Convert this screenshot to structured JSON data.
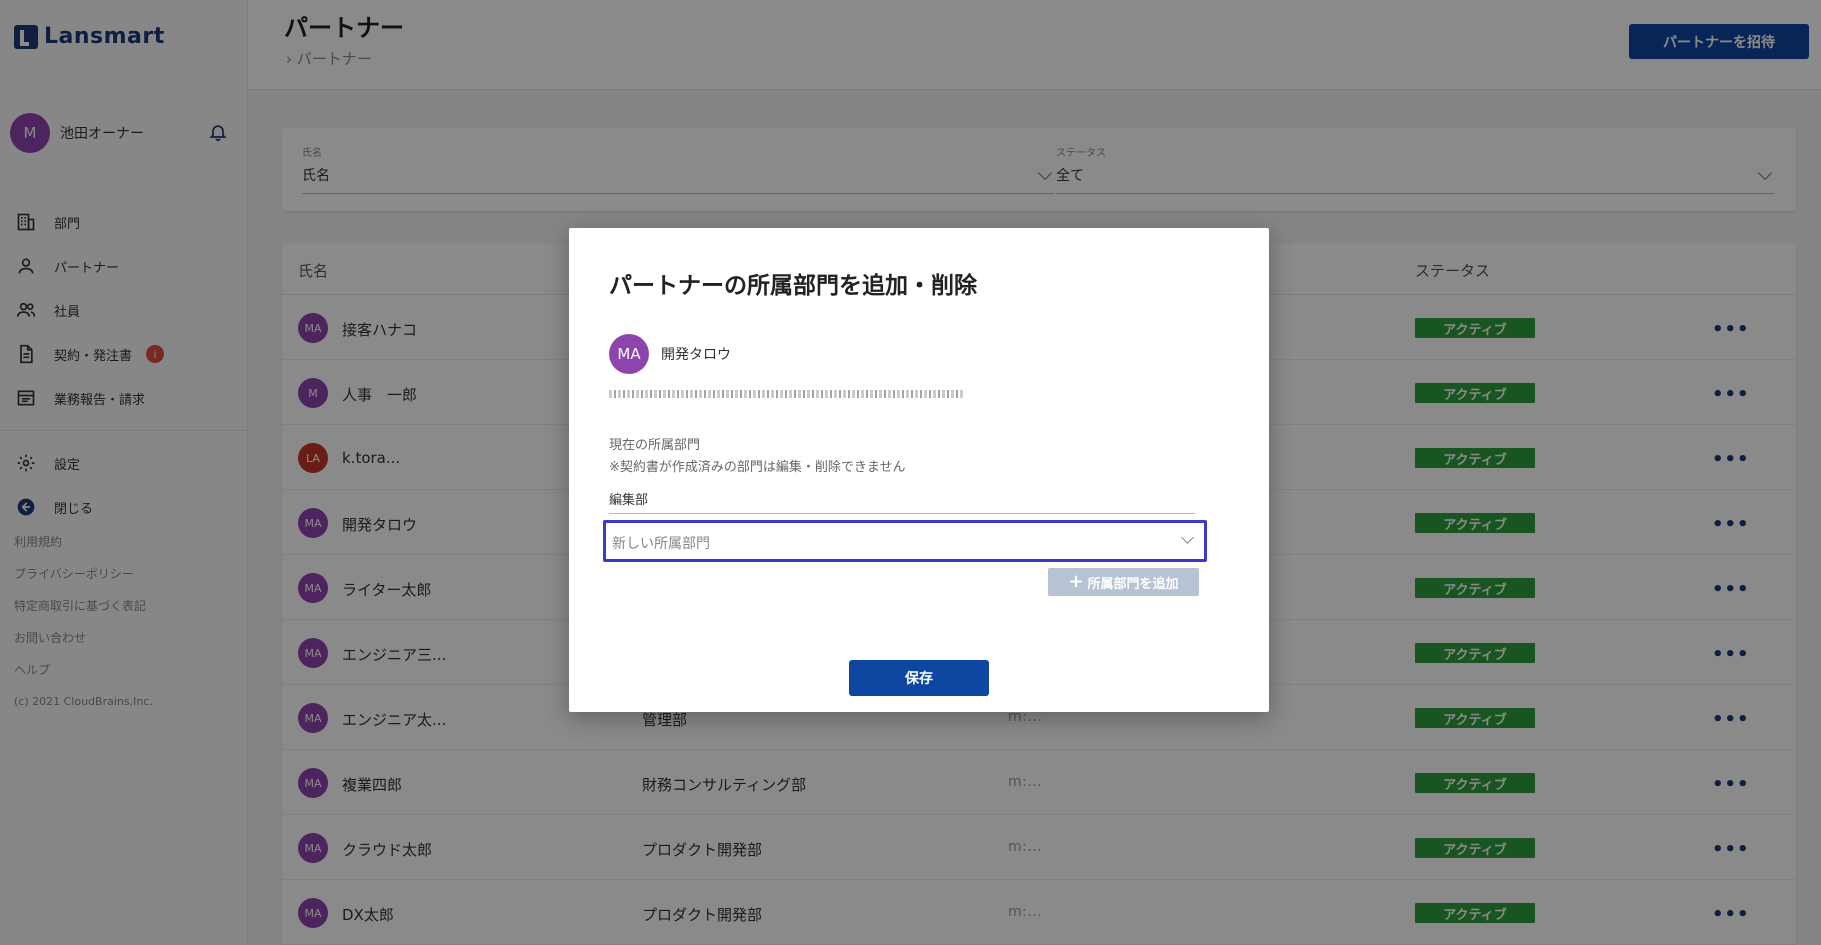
{
  "app": {
    "logo_text": "Lansmart"
  },
  "user": {
    "avatar_initial": "M",
    "name": "池田オーナー"
  },
  "sidebar": {
    "items": [
      {
        "label": "部門",
        "icon": "building-icon"
      },
      {
        "label": "パートナー",
        "icon": "person-icon"
      },
      {
        "label": "社員",
        "icon": "people-icon"
      },
      {
        "label": "契約・発注書",
        "icon": "document-icon",
        "badge": "i"
      },
      {
        "label": "業務報告・請求",
        "icon": "report-icon"
      }
    ],
    "secondary": [
      {
        "label": "設定",
        "icon": "gear-icon"
      },
      {
        "label": "閉じる",
        "icon": "arrow-left-icon"
      }
    ],
    "footer": [
      "利用規約",
      "プライバシーポリシー",
      "特定商取引に基づく表記",
      "お問い合わせ",
      "ヘルプ"
    ],
    "copyright": "(c) 2021 CloudBrains,Inc."
  },
  "header": {
    "title": "パートナー",
    "breadcrumb": "パートナー",
    "invite_button": "パートナーを招待"
  },
  "filters": {
    "name": {
      "label": "氏名",
      "value": "氏名"
    },
    "status": {
      "label": "ステータス",
      "value": "全て"
    }
  },
  "table": {
    "headers": {
      "name": "氏名",
      "status": "ステータス"
    },
    "rows": [
      {
        "initials": "MA",
        "name": "接客ハナコ",
        "dept": "",
        "email": "",
        "status": "アクティブ",
        "avatar_color": "#8e44ad"
      },
      {
        "initials": "M",
        "name": "人事　一郎",
        "dept": "",
        "email": "",
        "status": "アクティブ",
        "avatar_color": "#8e44ad"
      },
      {
        "initials": "LA",
        "name": "k.tora...",
        "dept": "",
        "email": "",
        "status": "アクティブ",
        "avatar_color": "#c0392b"
      },
      {
        "initials": "MA",
        "name": "開発タロウ",
        "dept": "",
        "email": "",
        "status": "アクティブ",
        "avatar_color": "#8e44ad"
      },
      {
        "initials": "MA",
        "name": "ライター太郎",
        "dept": "",
        "email": "",
        "status": "アクティブ",
        "avatar_color": "#8e44ad"
      },
      {
        "initials": "MA",
        "name": "エンジニア三...",
        "dept": "",
        "email": "",
        "status": "アクティブ",
        "avatar_color": "#8e44ad"
      },
      {
        "initials": "MA",
        "name": "エンジニア太...",
        "dept": "管理部",
        "email": "m:...",
        "status": "アクティブ",
        "avatar_color": "#8e44ad"
      },
      {
        "initials": "MA",
        "name": "複業四郎",
        "dept": "財務コンサルティング部",
        "email": "m:...",
        "status": "アクティブ",
        "avatar_color": "#8e44ad"
      },
      {
        "initials": "MA",
        "name": "クラウド太郎",
        "dept": "プロダクト開発部",
        "email": "m:...",
        "status": "アクティブ",
        "avatar_color": "#8e44ad"
      },
      {
        "initials": "MA",
        "name": "DX太郎",
        "dept": "プロダクト開発部",
        "email": "m:...",
        "status": "アクティブ",
        "avatar_color": "#8e44ad"
      }
    ]
  },
  "modal": {
    "title": "パートナーの所属部門を追加・削除",
    "avatar_initials": "MA",
    "partner_name": "開発タロウ",
    "current_dept_label": "現在の所属部門",
    "note": "※契約書が作成済みの部門は編集・削除できません",
    "current_dept_value": "編集部",
    "new_dept_placeholder": "新しい所属部門",
    "add_button": "所属部門を追加",
    "save_button": "保存"
  },
  "colors": {
    "brand": "#0d47a1",
    "status_active": "#2e9e3e",
    "focus_border": "#3b39c9"
  }
}
